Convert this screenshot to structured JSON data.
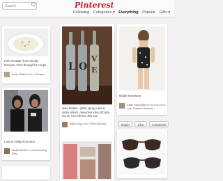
{
  "search": {
    "placeholder": "Search"
  },
  "header": {
    "logo": "Pinterest"
  },
  "nav": {
    "following": "Following",
    "categories": "Categories ▾",
    "everything": "Everything",
    "popular": "Popular",
    "gifts": "Gifts ▾"
  },
  "pins": [
    {
      "desc": "Fish Chowder from Simply Recipes. Click through for recipe",
      "user": "Andy Bibbett",
      "board": "Recipes",
      "onto": "onto"
    },
    {
      "desc": "wine bottles...glitter spray paint & sticky letters. Awesome idea @Carly Horne You will love this too!",
      "user": "Barb Kaye",
      "board": "Field Mousey",
      "onto": "onto",
      "bottle_letters": [
        "L",
        "O",
        "V",
        "E"
      ]
    },
    {
      "desc": "Model swimwear",
      "user": "Katie Sutherland",
      "board": "Summer Beauty",
      "onto": "via",
      "via": "Theresa Bown onto"
    },
    {
      "desc": "Love it! Helped me alot!",
      "user": "Nadia Fiefline",
      "board": "Amazing Tips",
      "onto": "onto"
    },
    {
      "desc": "",
      "user": "",
      "board": ""
    },
    {
      "desc": "",
      "user": "",
      "board": ""
    }
  ],
  "actions": {
    "repin": "Repin",
    "like": "Like",
    "comment": "Comment"
  }
}
